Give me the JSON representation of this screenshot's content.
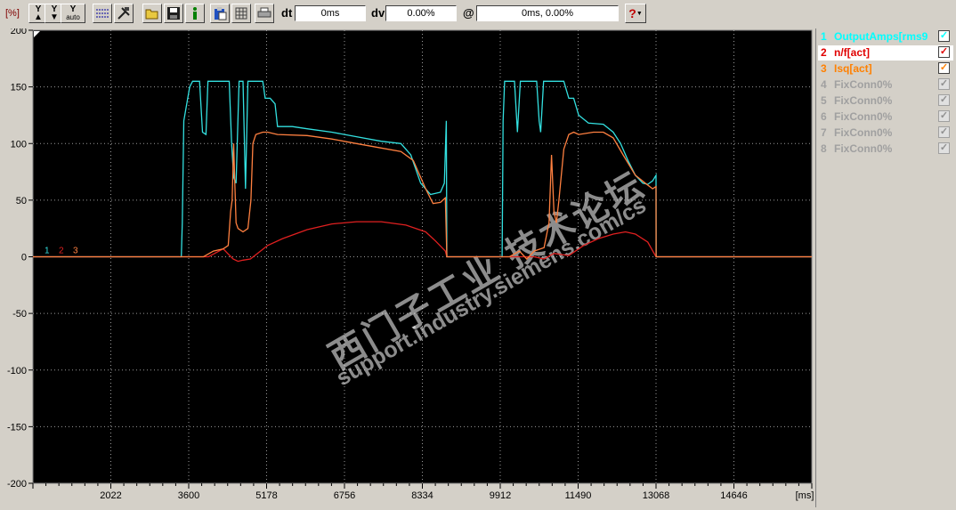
{
  "toolbar": {
    "unit_label": "[%]",
    "y_zoom_in_label": "Y",
    "y_zoom_out_label": "Y",
    "y_auto_label": "Y",
    "y_auto_sub": "auto",
    "dt_label": "dt",
    "dt_value": "0ms",
    "dv_label": "dv",
    "dv_value": "0.00%",
    "at_label": "@",
    "at_value": "0ms, 0.00%",
    "help_label": "?"
  },
  "legend": [
    {
      "num": "1",
      "name": "OutputAmps[rms9",
      "color": "#00ffff",
      "checked": true,
      "selected": false
    },
    {
      "num": "2",
      "name": "n/f[act]",
      "color": "#e00000",
      "checked": true,
      "selected": true
    },
    {
      "num": "3",
      "name": "Isq[act]",
      "color": "#ff8000",
      "checked": true,
      "selected": false
    },
    {
      "num": "4",
      "name": "FixConn0%",
      "color": "#a0a0a0",
      "checked": true,
      "selected": false
    },
    {
      "num": "5",
      "name": "FixConn0%",
      "color": "#a0a0a0",
      "checked": true,
      "selected": false
    },
    {
      "num": "6",
      "name": "FixConn0%",
      "color": "#a0a0a0",
      "checked": true,
      "selected": false
    },
    {
      "num": "7",
      "name": "FixConn0%",
      "color": "#a0a0a0",
      "checked": true,
      "selected": false
    },
    {
      "num": "8",
      "name": "FixConn0%",
      "color": "#a0a0a0",
      "checked": true,
      "selected": false
    }
  ],
  "watermark": [
    "西门子工业 技术论坛",
    "support.industry.siemens.com/cs"
  ],
  "chart_data": {
    "type": "line",
    "xlim": [
      444,
      16224
    ],
    "ylim": [
      -200,
      200
    ],
    "xticks": [
      2022,
      3600,
      5178,
      6756,
      8334,
      9912,
      11490,
      13068,
      14646
    ],
    "yticks": [
      200,
      150,
      100,
      50,
      0,
      -50,
      -100,
      -150,
      -200
    ],
    "xunit": "[ms]",
    "trace_markers": [
      "1",
      "2",
      "3"
    ],
    "grid": true,
    "series": [
      {
        "name": "OutputAmps[rms9",
        "color": "#33e0e0",
        "points": [
          [
            444,
            0
          ],
          [
            3450,
            0
          ],
          [
            3470,
            30
          ],
          [
            3500,
            120
          ],
          [
            3620,
            150
          ],
          [
            3680,
            155
          ],
          [
            3820,
            155
          ],
          [
            3880,
            110
          ],
          [
            3950,
            108
          ],
          [
            3990,
            155
          ],
          [
            4420,
            155
          ],
          [
            4470,
            100
          ],
          [
            4510,
            70
          ],
          [
            4560,
            65
          ],
          [
            4620,
            155
          ],
          [
            4700,
            155
          ],
          [
            4750,
            60
          ],
          [
            4800,
            155
          ],
          [
            5100,
            155
          ],
          [
            5150,
            140
          ],
          [
            5250,
            140
          ],
          [
            5350,
            135
          ],
          [
            5400,
            115
          ],
          [
            5700,
            115
          ],
          [
            6000,
            113
          ],
          [
            6500,
            110
          ],
          [
            7000,
            106
          ],
          [
            7500,
            102
          ],
          [
            7900,
            100
          ],
          [
            8100,
            90
          ],
          [
            8300,
            65
          ],
          [
            8500,
            55
          ],
          [
            8700,
            57
          ],
          [
            8780,
            65
          ],
          [
            8820,
            120
          ],
          [
            8830,
            0
          ],
          [
            9950,
            0
          ],
          [
            9970,
            120
          ],
          [
            10000,
            155
          ],
          [
            10200,
            155
          ],
          [
            10260,
            110
          ],
          [
            10320,
            155
          ],
          [
            10650,
            155
          ],
          [
            10700,
            120
          ],
          [
            10730,
            110
          ],
          [
            10790,
            155
          ],
          [
            11200,
            155
          ],
          [
            11300,
            140
          ],
          [
            11400,
            140
          ],
          [
            11500,
            125
          ],
          [
            11700,
            118
          ],
          [
            12000,
            117
          ],
          [
            12200,
            110
          ],
          [
            12350,
            100
          ],
          [
            12500,
            85
          ],
          [
            12650,
            72
          ],
          [
            12800,
            65
          ],
          [
            12900,
            64
          ],
          [
            13000,
            67
          ],
          [
            13068,
            72
          ],
          [
            13070,
            0
          ],
          [
            16224,
            0
          ]
        ]
      },
      {
        "name": "n/f[act]",
        "color": "#e02020",
        "points": [
          [
            444,
            0
          ],
          [
            4000,
            0
          ],
          [
            4300,
            7
          ],
          [
            4500,
            -2
          ],
          [
            4600,
            -4
          ],
          [
            4700,
            -3
          ],
          [
            4850,
            -2
          ],
          [
            5200,
            10
          ],
          [
            5500,
            16
          ],
          [
            6000,
            24
          ],
          [
            6500,
            29
          ],
          [
            7000,
            31
          ],
          [
            7500,
            31
          ],
          [
            8000,
            28
          ],
          [
            8400,
            22
          ],
          [
            8600,
            14
          ],
          [
            8800,
            5
          ],
          [
            8830,
            0
          ],
          [
            10600,
            0
          ],
          [
            10800,
            -2
          ],
          [
            11000,
            3
          ],
          [
            11300,
            1
          ],
          [
            11600,
            10
          ],
          [
            11900,
            16
          ],
          [
            12200,
            20
          ],
          [
            12450,
            22
          ],
          [
            12650,
            20
          ],
          [
            12900,
            13
          ],
          [
            13068,
            0
          ],
          [
            16224,
            0
          ]
        ]
      },
      {
        "name": "Isq[act]",
        "color": "#ff8040",
        "points": [
          [
            444,
            0
          ],
          [
            3900,
            0
          ],
          [
            4100,
            5
          ],
          [
            4300,
            7
          ],
          [
            4400,
            10
          ],
          [
            4450,
            40
          ],
          [
            4480,
            50
          ],
          [
            4510,
            100
          ],
          [
            4530,
            70
          ],
          [
            4560,
            30
          ],
          [
            4600,
            25
          ],
          [
            4700,
            22
          ],
          [
            4800,
            25
          ],
          [
            4860,
            50
          ],
          [
            4900,
            100
          ],
          [
            4960,
            108
          ],
          [
            5100,
            110
          ],
          [
            5200,
            110
          ],
          [
            5400,
            108
          ],
          [
            6000,
            107
          ],
          [
            6500,
            104
          ],
          [
            7000,
            100
          ],
          [
            7500,
            96
          ],
          [
            7900,
            93
          ],
          [
            8150,
            85
          ],
          [
            8400,
            60
          ],
          [
            8550,
            47
          ],
          [
            8700,
            48
          ],
          [
            8800,
            52
          ],
          [
            8830,
            0
          ],
          [
            10100,
            0
          ],
          [
            10300,
            5
          ],
          [
            10450,
            -2
          ],
          [
            10600,
            5
          ],
          [
            10800,
            8
          ],
          [
            10900,
            30
          ],
          [
            10950,
            90
          ],
          [
            11000,
            40
          ],
          [
            11050,
            30
          ],
          [
            11100,
            50
          ],
          [
            11200,
            95
          ],
          [
            11300,
            108
          ],
          [
            11400,
            110
          ],
          [
            11500,
            108
          ],
          [
            11800,
            110
          ],
          [
            12000,
            110
          ],
          [
            12200,
            105
          ],
          [
            12400,
            90
          ],
          [
            12650,
            72
          ],
          [
            12850,
            65
          ],
          [
            13000,
            60
          ],
          [
            13068,
            62
          ],
          [
            13070,
            0
          ],
          [
            16224,
            0
          ]
        ]
      }
    ]
  }
}
